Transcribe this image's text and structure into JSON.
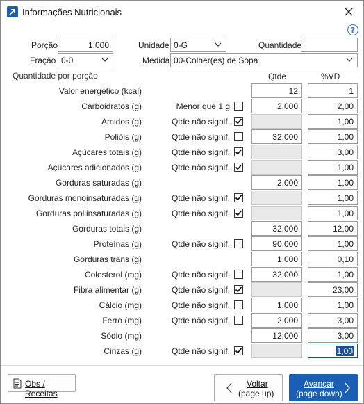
{
  "window": {
    "title": "Informações Nutricionais"
  },
  "header": {
    "porcao_label": "Porção",
    "porcao_value": "1,000",
    "unidade_label": "Unidade",
    "unidade_value": "0-G",
    "quantidade_label": "Quantidade",
    "quantidade_value": "",
    "fracao_label": "Fração",
    "fracao_value": "0-0",
    "medida_label": "Medida",
    "medida_value": "00-Colher(es) de Sopa"
  },
  "group": {
    "title": "Quantidade por porção",
    "qtde_header": "Qtde",
    "vd_header": "%VD"
  },
  "rows": [
    {
      "label": "Valor energético (kcal)",
      "flag_label": "",
      "checked": null,
      "qtde": "12",
      "qtde_disabled": false,
      "vd": "1"
    },
    {
      "label": "Carboidratos (g)",
      "flag_label": "Menor que 1 g",
      "checked": false,
      "qtde": "2,000",
      "qtde_disabled": false,
      "vd": "2,00"
    },
    {
      "label": "Amidos (g)",
      "flag_label": "Qtde não signif.",
      "checked": true,
      "qtde": "",
      "qtde_disabled": true,
      "vd": "1,00"
    },
    {
      "label": "Polióis (g)",
      "flag_label": "Qtde não signif.",
      "checked": false,
      "qtde": "32,000",
      "qtde_disabled": false,
      "vd": "1,00"
    },
    {
      "label": "Açúcares totais (g)",
      "flag_label": "Qtde não signif.",
      "checked": true,
      "qtde": "",
      "qtde_disabled": true,
      "vd": "3,00"
    },
    {
      "label": "Açúcares adicionados (g)",
      "flag_label": "Qtde não signif.",
      "checked": true,
      "qtde": "",
      "qtde_disabled": true,
      "vd": "1,00"
    },
    {
      "label": "Gorduras saturadas (g)",
      "flag_label": "",
      "checked": null,
      "qtde": "2,000",
      "qtde_disabled": false,
      "vd": "1,00"
    },
    {
      "label": "Gorduras monoinsaturadas (g)",
      "flag_label": "Qtde não signif.",
      "checked": true,
      "qtde": "",
      "qtde_disabled": true,
      "vd": "1,00"
    },
    {
      "label": "Gorduras poliinsaturadas (g)",
      "flag_label": "Qtde não signif.",
      "checked": true,
      "qtde": "",
      "qtde_disabled": true,
      "vd": "1,00"
    },
    {
      "label": "Gorduras totais (g)",
      "flag_label": "",
      "checked": null,
      "qtde": "32,000",
      "qtde_disabled": false,
      "vd": "12,00"
    },
    {
      "label": "Proteínas (g)",
      "flag_label": "Qtde não signif.",
      "checked": false,
      "qtde": "90,000",
      "qtde_disabled": false,
      "vd": "1,00"
    },
    {
      "label": "Gorduras trans (g)",
      "flag_label": "",
      "checked": null,
      "qtde": "1,000",
      "qtde_disabled": false,
      "vd": "0,10"
    },
    {
      "label": "Colesterol (mg)",
      "flag_label": "Qtde não signif.",
      "checked": false,
      "qtde": "32,000",
      "qtde_disabled": false,
      "vd": "1,00"
    },
    {
      "label": "Fibra alimentar (g)",
      "flag_label": "Qtde não signif.",
      "checked": true,
      "qtde": "",
      "qtde_disabled": true,
      "vd": "23,00"
    },
    {
      "label": "Cálcio (mg)",
      "flag_label": "Qtde não signif.",
      "checked": false,
      "qtde": "1,000",
      "qtde_disabled": false,
      "vd": "1,00"
    },
    {
      "label": "Ferro (mg)",
      "flag_label": "Qtde não signif.",
      "checked": false,
      "qtde": "2,000",
      "qtde_disabled": false,
      "vd": "3,00"
    },
    {
      "label": "Sódio (mg)",
      "flag_label": "",
      "checked": null,
      "qtde": "12,000",
      "qtde_disabled": false,
      "vd": "3,00"
    },
    {
      "label": "Cinzas (g)",
      "flag_label": "Qtde não signif.",
      "checked": true,
      "qtde": "",
      "qtde_disabled": true,
      "vd": "1,00",
      "vd_selected": true
    }
  ],
  "footer": {
    "obs_label": "Obs / Receitas",
    "voltar_label": "Voltar",
    "voltar_hint": "(page up)",
    "avancar_label": "Avançar",
    "avancar_hint": "(page down)"
  },
  "icons": {
    "app": "app-arrow-icon",
    "close": "close-icon",
    "help": "help-icon",
    "obs": "document-icon",
    "voltar": "chevron-left-icon",
    "avancar": "chevron-right-icon"
  },
  "colors": {
    "accent": "#1a5fb4",
    "focus_border": "#1a4fa0",
    "disabled_fill": "#e9e9e9"
  }
}
